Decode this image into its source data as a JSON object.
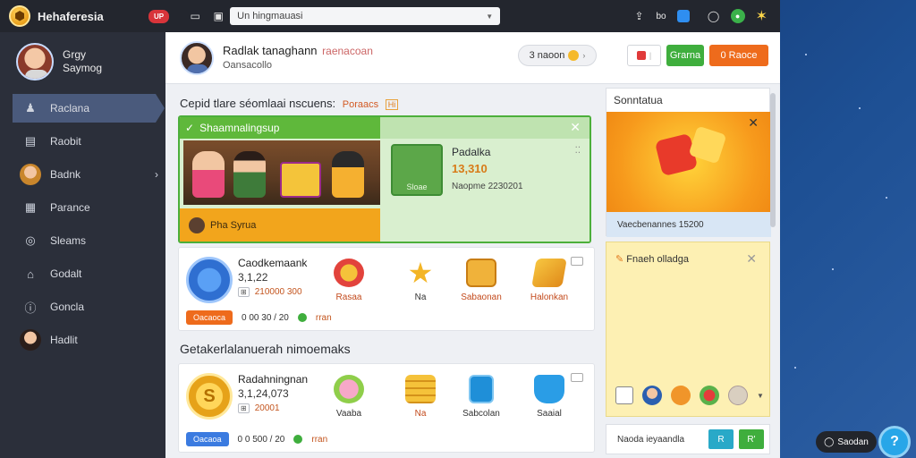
{
  "topbar": {
    "app_title": "Hehaferesia",
    "badge": "UP",
    "search_value": "Un hingmauasi",
    "right_text": "bo"
  },
  "sidebar": {
    "profile_name_1": "Grgy",
    "profile_name_2": "Saymog",
    "items": [
      {
        "label": "Raclana",
        "icon": "user-icon"
      },
      {
        "label": "Raobit",
        "icon": "inbox-icon"
      },
      {
        "label": "Badnk",
        "icon": "avatar-icon"
      },
      {
        "label": "Parance",
        "icon": "grid-icon"
      },
      {
        "label": "Sleams",
        "icon": "coin-icon"
      },
      {
        "label": "Godalt",
        "icon": "person-icon"
      },
      {
        "label": "Goncla",
        "icon": "info-icon"
      },
      {
        "label": "Hadlit",
        "icon": "avatar-icon"
      }
    ]
  },
  "header": {
    "name": "Radlak tanaghann",
    "name_sub": "raenacoan",
    "status": "Oansacollo",
    "coins": "3 naoon",
    "btn_green": "Grarna",
    "btn_orange": "0 Raoce"
  },
  "section1": {
    "title": "Cepid tlare séomlaai nscuens:",
    "tag": "Poraacs",
    "mini": "Hi"
  },
  "promo": {
    "head": "Shaamnalingsup",
    "foot": "Pha Syrua",
    "box_label": "Sloae",
    "name": "Padalka",
    "number": "13,310",
    "meta": "Naopme 2230201",
    "arrow": "⁚⁚"
  },
  "card1": {
    "coin_label": "",
    "name": "Caodkemaank",
    "number": "3,1,22",
    "sub_value": "210000 300",
    "foot_btn": "Oacaoca",
    "foot_text": "0 00 30 / 20",
    "foot_tail": "rran",
    "rewards": [
      "Rasaa",
      "Na",
      "Sabaonan",
      "Halonkan"
    ]
  },
  "section2": {
    "title": "Getakerlalanuerah nimoemaks"
  },
  "card2": {
    "coin_label": "S",
    "name": "Radahningnan",
    "number": "3,1,24,073",
    "sub_value": "20001",
    "foot_btn": "Oacaoa",
    "foot_text": "0 0 500 / 20",
    "foot_tail": "rran",
    "rewards": [
      "Vaaba",
      "Na",
      "Sabcolan",
      "Saaial"
    ]
  },
  "right_panel": {
    "top_title": "Sonntatua",
    "top_foot": "Vaecbenannes 15200",
    "mid_title": "Fnaeh olladga",
    "bottom_text": "Naoda ieyaandla",
    "bottom_b1": "R",
    "bottom_b2": "R'"
  },
  "floating": {
    "chat": "Saodan",
    "help": "?"
  },
  "colors": {
    "accent_green": "#3fae3d",
    "accent_orange": "#ee6b1c",
    "sidebar_bg": "#2b2f3a",
    "topbar_bg": "#23262e"
  }
}
